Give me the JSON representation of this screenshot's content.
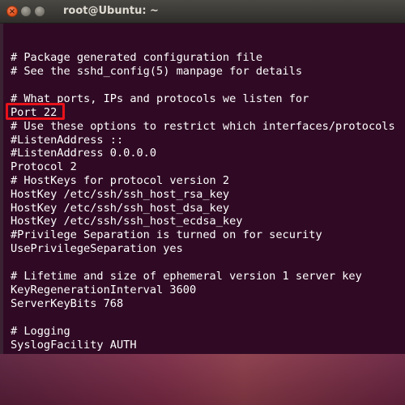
{
  "window": {
    "title": "root@Ubuntu: ~",
    "close_glyph": "×",
    "min_glyph": "",
    "max_glyph": ""
  },
  "terminal": {
    "lines": [
      "# Package generated configuration file",
      "# See the sshd_config(5) manpage for details",
      "",
      "# What ports, IPs and protocols we listen for",
      "Port 22",
      "# Use these options to restrict which interfaces/protocols",
      "#ListenAddress ::",
      "#ListenAddress 0.0.0.0",
      "Protocol 2",
      "# HostKeys for protocol version 2",
      "HostKey /etc/ssh/ssh_host_rsa_key",
      "HostKey /etc/ssh/ssh_host_dsa_key",
      "HostKey /etc/ssh/ssh_host_ecdsa_key",
      "#Privilege Separation is turned on for security",
      "UsePrivilegeSeparation yes",
      "",
      "# Lifetime and size of ephemeral version 1 server key",
      "KeyRegenerationInterval 3600",
      "ServerKeyBits 768",
      "",
      "# Logging",
      "SyslogFacility AUTH"
    ]
  },
  "colors": {
    "terminal_bg": "#300a24",
    "terminal_fg": "#ffffff",
    "highlight_border": "#e8121a",
    "titlebar": "#3c3b37"
  }
}
